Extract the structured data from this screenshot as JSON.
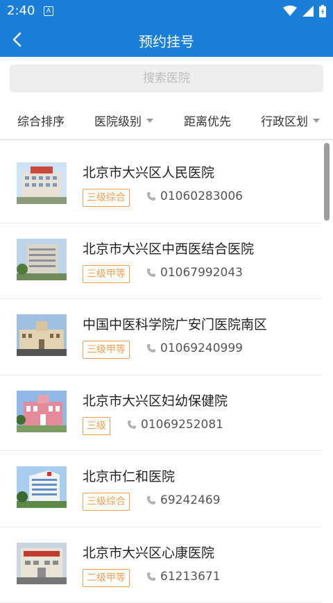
{
  "status": {
    "time": "2:40",
    "notif_letter": "A"
  },
  "header": {
    "title": "预约挂号"
  },
  "search": {
    "placeholder": "搜索医院"
  },
  "filters": [
    {
      "label": "综合排序",
      "dropdown": false
    },
    {
      "label": "医院级别",
      "dropdown": true
    },
    {
      "label": "距离优先",
      "dropdown": false
    },
    {
      "label": "行政区划",
      "dropdown": true
    }
  ],
  "hospitals": [
    {
      "name": "北京市大兴区人民医院",
      "level": "三级综合",
      "phone": "01060283006"
    },
    {
      "name": "北京市大兴区中西医结合医院",
      "level": "三级甲等",
      "phone": "01067992043"
    },
    {
      "name": "中国中医科学院广安门医院南区",
      "level": "三级甲等",
      "phone": "01069240999"
    },
    {
      "name": "北京市大兴区妇幼保健院",
      "level": "三级",
      "phone": "01069252081"
    },
    {
      "name": "北京市仁和医院",
      "level": "三级综合",
      "phone": "69242469"
    },
    {
      "name": "北京市大兴区心康医院",
      "level": "二级甲等",
      "phone": "61213671"
    }
  ],
  "colors": {
    "primary": "#1a7fd8",
    "badge": "#f0a04b",
    "text": "#222222"
  }
}
